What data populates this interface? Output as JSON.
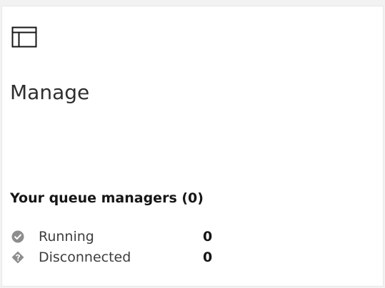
{
  "tile": {
    "icon": "application-window-icon",
    "title": "Manage"
  },
  "queue_managers": {
    "heading": "Your queue managers (0)",
    "statuses": [
      {
        "label": "Running",
        "count": "0",
        "icon": "checkmark-filled-icon",
        "color": "#8d8d8d"
      },
      {
        "label": "Disconnected",
        "count": "0",
        "icon": "warning-diamond-icon",
        "color": "#8d8d8d"
      }
    ]
  }
}
